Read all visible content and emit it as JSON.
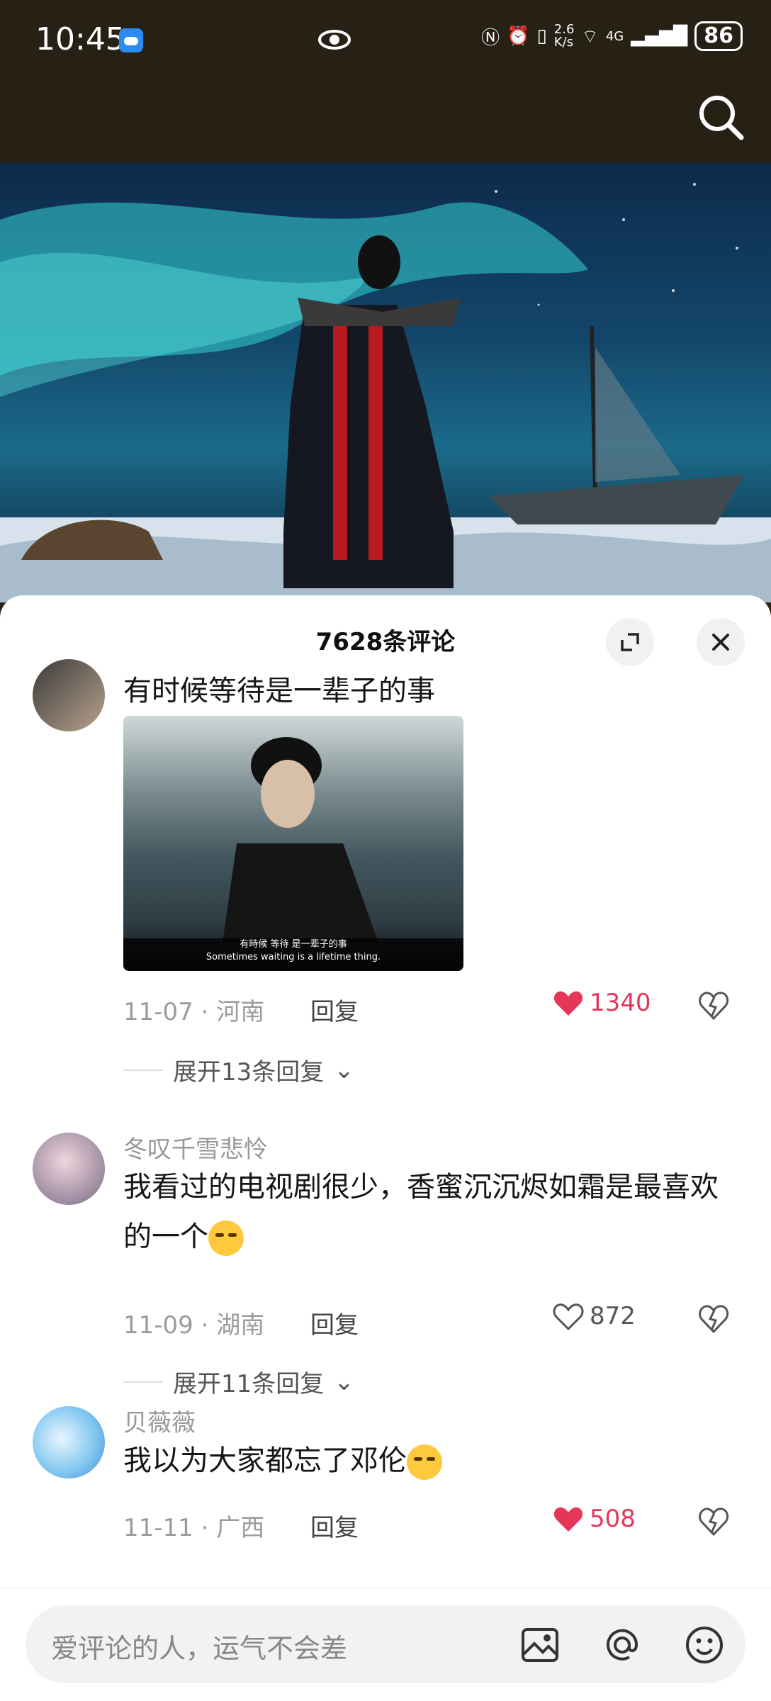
{
  "status_bar": {
    "time": "10:45",
    "network_speed": "2.6\nK/s",
    "signal": "4G",
    "battery": "86"
  },
  "sheet": {
    "title": "7628条评论"
  },
  "comments": [
    {
      "user": "",
      "text": "有时候等待是一辈子的事",
      "image_caption_zh": "有時候 等待 是一辈子的事",
      "image_caption_en": "Sometimes waiting is a lifetime thing.",
      "date_location": "11-07 · 河南",
      "reply_label": "回复",
      "likes": "1340",
      "liked": true,
      "expand_label": "展开13条回复"
    },
    {
      "user": "冬叹千雪悲怜",
      "text": "我看过的电视剧很少，香蜜沉沉烬如霜是最喜欢的一个",
      "date_location": "11-09 · 湖南",
      "reply_label": "回复",
      "likes": "872",
      "liked": false,
      "expand_label": "展开11条回复"
    },
    {
      "user": "贝薇薇",
      "text": "我以为大家都忘了邓伦",
      "date_location": "11-11 · 广西",
      "reply_label": "回复",
      "likes": "508",
      "liked": true
    }
  ],
  "input": {
    "placeholder": "爱评论的人，运气不会差"
  },
  "colors": {
    "accent_like": "#e5365a",
    "sheet_bg": "#ffffff",
    "top_bg": "#262114"
  }
}
